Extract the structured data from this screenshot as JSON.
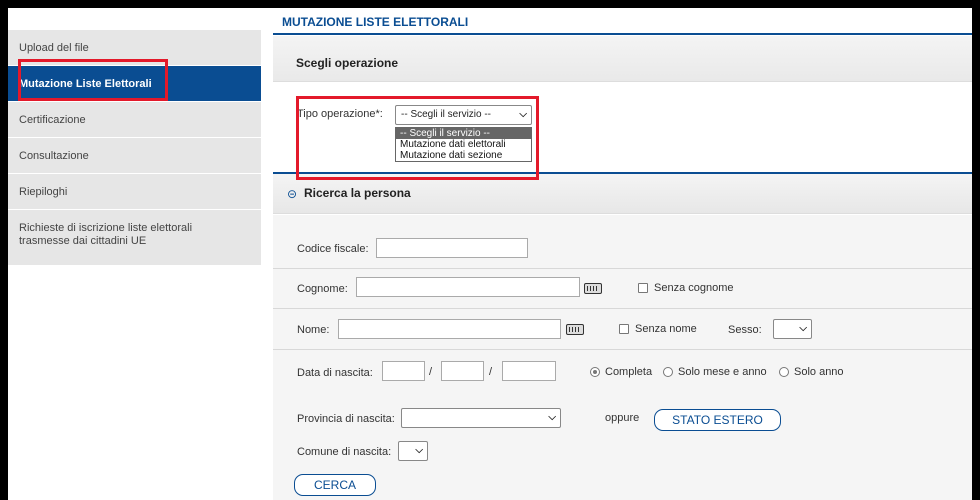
{
  "sidebar": {
    "items": [
      {
        "label": "Upload del file"
      },
      {
        "label": "Mutazione Liste Elettorali"
      },
      {
        "label": "Certificazione"
      },
      {
        "label": "Consultazione"
      },
      {
        "label": "Riepiloghi"
      },
      {
        "label": "Richieste di iscrizione liste elettorali trasmesse dai cittadini UE"
      }
    ],
    "active_index": 1
  },
  "header": {
    "title": "MUTAZIONE LISTE ELETTORALI"
  },
  "operazione": {
    "panel_title": "Scegli operazione",
    "tipo_label": "Tipo operazione*:",
    "selected": "-- Scegli il servizio --",
    "options": [
      "-- Scegli il servizio --",
      "Mutazione dati elettorali",
      "Mutazione dati sezione"
    ]
  },
  "ricerca": {
    "title": "Ricerca la persona",
    "codice_fiscale_label": "Codice fiscale:",
    "cognome_label": "Cognome:",
    "senza_cognome_label": "Senza cognome",
    "nome_label": "Nome:",
    "senza_nome_label": "Senza nome",
    "sesso_label": "Sesso:",
    "data_nascita_label": "Data di nascita:",
    "date_sep": "/",
    "radio_completa": "Completa",
    "radio_mese_anno": "Solo mese e anno",
    "radio_anno": "Solo anno",
    "provincia_label": "Provincia di nascita:",
    "oppure_label": "oppure",
    "stato_estero_button": "STATO ESTERO",
    "comune_label": "Comune di nascita:",
    "cerca_button": "CERCA"
  },
  "colors": {
    "accent": "#0a4d92",
    "highlight": "#e3192a"
  }
}
